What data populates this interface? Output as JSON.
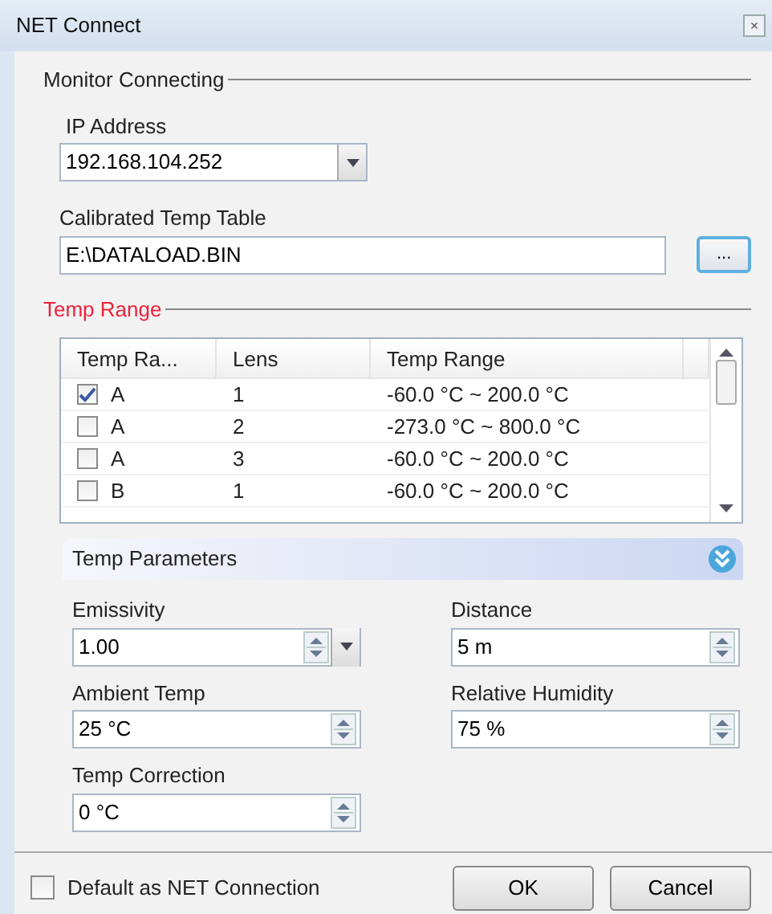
{
  "window": {
    "title": "NET Connect",
    "close": "×"
  },
  "monitor": {
    "legend": "Monitor Connecting",
    "ip_label": "IP Address",
    "ip_value": "192.168.104.252",
    "table_label": "Calibrated Temp Table",
    "table_value": "E:\\DATALOAD.BIN",
    "browse": "..."
  },
  "temp_range": {
    "legend": "Temp Range",
    "columns": [
      "Temp Ra...",
      "Lens",
      "Temp Range"
    ],
    "rows": [
      {
        "checked": true,
        "range": "A",
        "lens": "1",
        "temp": "-60.0 °C ~ 200.0 °C"
      },
      {
        "checked": false,
        "range": "A",
        "lens": "2",
        "temp": "-273.0 °C ~ 800.0 °C"
      },
      {
        "checked": false,
        "range": "A",
        "lens": "3",
        "temp": "-60.0 °C ~ 200.0 °C"
      },
      {
        "checked": false,
        "range": "B",
        "lens": "1",
        "temp": "-60.0 °C ~ 200.0 °C"
      }
    ]
  },
  "temp_parameters": {
    "title": "Temp Parameters",
    "expanded": true,
    "fields": [
      {
        "label": "Emissivity",
        "value": "1.00",
        "kind": "dropdown"
      },
      {
        "label": "Distance",
        "value": "5 m",
        "kind": "spin"
      },
      {
        "label": "Ambient Temp",
        "value": "25 °C",
        "kind": "spin"
      },
      {
        "label": "Relative Humidity",
        "value": "75 %",
        "kind": "spin"
      },
      {
        "label": "Temp Correction",
        "value": "0 °C",
        "kind": "spin"
      }
    ]
  },
  "footer": {
    "default_label": "Default as NET Connection",
    "default_checked": false,
    "buttons": [
      "OK",
      "Cancel"
    ]
  }
}
